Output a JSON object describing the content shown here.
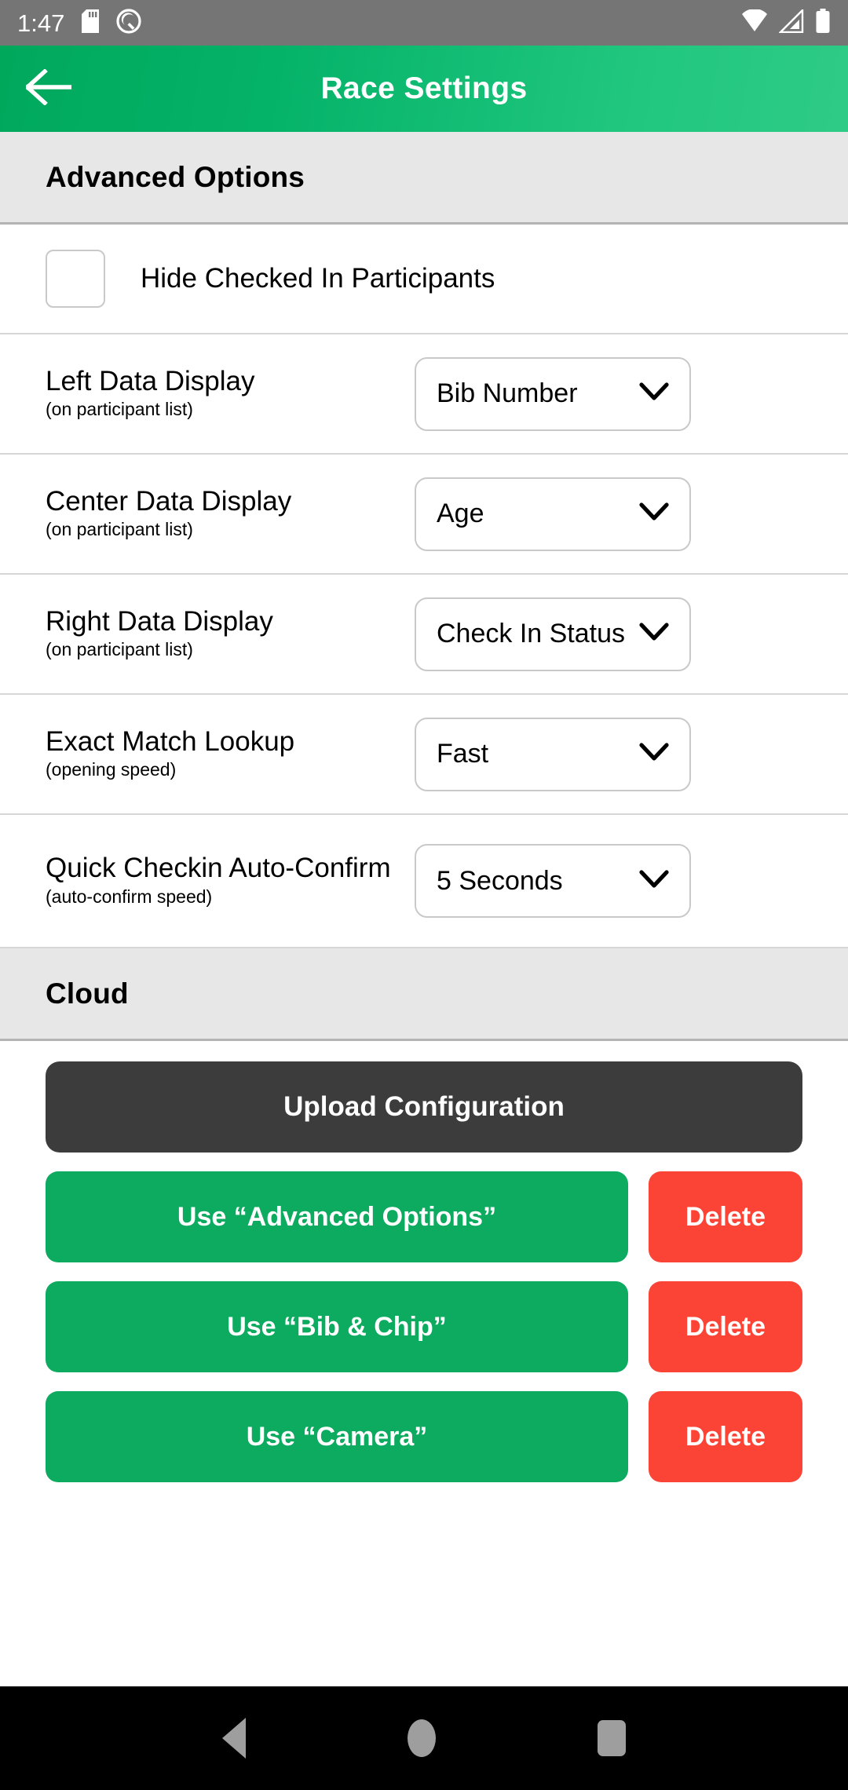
{
  "status_bar": {
    "time": "1:47",
    "icons_left": [
      "sd-card-icon",
      "android-q-icon"
    ],
    "icons_right": [
      "wifi-icon",
      "cellular-signal-icon",
      "battery-icon"
    ],
    "background_color": "#757575"
  },
  "app_bar": {
    "title": "Race Settings",
    "back_icon": "arrow-left-icon",
    "gradient_start": "#00a85c",
    "gradient_end": "#2ecb86"
  },
  "sections": {
    "advanced": {
      "header": "Advanced Options",
      "checkbox": {
        "label": "Hide Checked In Participants",
        "checked": false
      },
      "rows": [
        {
          "label": "Left Data Display",
          "sublabel": "(on participant list)",
          "value": "Bib Number"
        },
        {
          "label": "Center Data Display",
          "sublabel": "(on participant list)",
          "value": "Age"
        },
        {
          "label": "Right Data Display",
          "sublabel": "(on participant list)",
          "value": "Check In Status"
        },
        {
          "label": "Exact Match Lookup",
          "sublabel": "(opening speed)",
          "value": "Fast"
        },
        {
          "label": "Quick Checkin Auto-Confirm",
          "sublabel": "(auto-confirm speed)",
          "value": "5 Seconds"
        }
      ]
    },
    "cloud": {
      "header": "Cloud",
      "upload_label": "Upload Configuration",
      "configs": [
        {
          "use_label": "Use “Advanced Options”",
          "delete_label": "Delete"
        },
        {
          "use_label": "Use “Bib & Chip”",
          "delete_label": "Delete"
        },
        {
          "use_label": "Use “Camera”",
          "delete_label": "Delete"
        }
      ]
    }
  },
  "nav_bar": {
    "back_icon": "triangle-back-icon",
    "home_icon": "circle-home-icon",
    "recents_icon": "square-recents-icon",
    "background_color": "#000000"
  },
  "colors": {
    "accent_green": "#0cab60",
    "danger_red": "#fc4436",
    "dark_button": "#3c3c3c",
    "section_gray": "#e7e7e7"
  }
}
